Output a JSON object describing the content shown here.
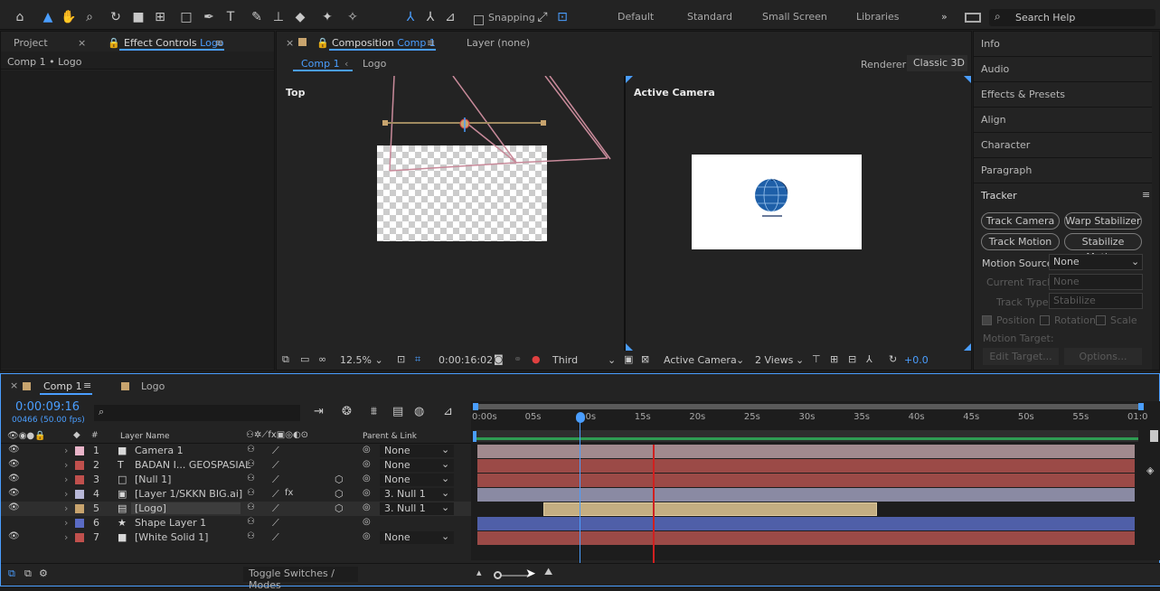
{
  "toolbar": {
    "snapping": "Snapping",
    "workspaces": [
      "Default",
      "Standard",
      "Small Screen",
      "Libraries"
    ],
    "search_placeholder": "Search Help"
  },
  "left_panel": {
    "tab_project": "Project",
    "tab_effect_controls": "Effect Controls",
    "effect_target": "Logo",
    "breadcrumb": "Comp 1 • Logo"
  },
  "comp_panel": {
    "tab_composition": "Composition",
    "comp_name": "Comp 1",
    "tab_layer": "Layer (none)",
    "crumb_comp": "Comp 1",
    "crumb_layer": "Logo",
    "renderer_label": "Renderer:",
    "renderer_value": "Classic 3D",
    "view_left": "Top",
    "view_right": "Active Camera"
  },
  "viewer_bar": {
    "zoom": "12.5%",
    "timecode": "0:00:16:02",
    "view_mode": "Third",
    "camera": "Active Camera",
    "views": "2 Views",
    "exposure": "+0.0"
  },
  "right_panel": {
    "items": [
      "Info",
      "Audio",
      "Effects & Presets",
      "Align",
      "Character",
      "Paragraph"
    ],
    "tracker_title": "Tracker",
    "buttons": [
      "Track Camera",
      "Warp Stabilizer",
      "Track Motion",
      "Stabilize Motion"
    ],
    "motion_source_label": "Motion Source:",
    "motion_source": "None",
    "current_track_label": "Current Track:",
    "current_track": "None",
    "track_type_label": "Track Type:",
    "track_type": "Stabilize",
    "position": "Position",
    "rotation": "Rotation",
    "scale": "Scale",
    "motion_target": "Motion Target:",
    "edit_target": "Edit Target...",
    "options": "Options..."
  },
  "timeline": {
    "tab_comp": "Comp 1",
    "tab_logo": "Logo",
    "timecode": "0:00:09:16",
    "frames": "00466 (50.00 fps)",
    "col_layer_name": "Layer Name",
    "col_parent": "Parent & Link",
    "col_num": "#",
    "toggle": "Toggle Switches / Modes",
    "ticks": [
      "0:00s",
      "05s",
      "10s",
      "15s",
      "20s",
      "25s",
      "30s",
      "35s",
      "40s",
      "45s",
      "50s",
      "55s",
      "01:0"
    ],
    "layers": [
      {
        "num": "1",
        "icon": "camera",
        "name": "Camera 1",
        "parent": "None",
        "color": "#e8b4c8",
        "bar_color": "#a18a8e",
        "start": 0,
        "end": 60
      },
      {
        "num": "2",
        "icon": "T",
        "name": "BADAN I... GEOSPASIAL",
        "parent": "None",
        "color": "#c0504d",
        "bar_color": "#9b4a47",
        "start": 0,
        "end": 60
      },
      {
        "num": "3",
        "icon": "null",
        "name": "[Null 1]",
        "parent": "None",
        "color": "#c0504d",
        "bar_color": "#9b4a47",
        "start": 0,
        "end": 60
      },
      {
        "num": "4",
        "icon": "ai",
        "name": "[Layer 1/SKKN BIG.ai]",
        "parent": "3. Null 1",
        "color": "#b8b8d8",
        "bar_color": "#8a8aa3",
        "start": 0,
        "end": 60
      },
      {
        "num": "5",
        "icon": "img",
        "name": "[Logo]",
        "parent": "3. Null 1",
        "color": "#c8a46e",
        "bar_color": "#c4ae82",
        "start": 6,
        "end": 36.5
      },
      {
        "num": "6",
        "icon": "star",
        "name": "Shape Layer 1",
        "parent": "",
        "color": "#5a6bc4",
        "bar_color": "#4f5fa8",
        "start": 0,
        "end": 60
      },
      {
        "num": "7",
        "icon": "solid",
        "name": "[White Solid 1]",
        "parent": "None",
        "color": "#c0504d",
        "bar_color": "#9b4a47",
        "start": 0,
        "end": 60
      }
    ]
  }
}
